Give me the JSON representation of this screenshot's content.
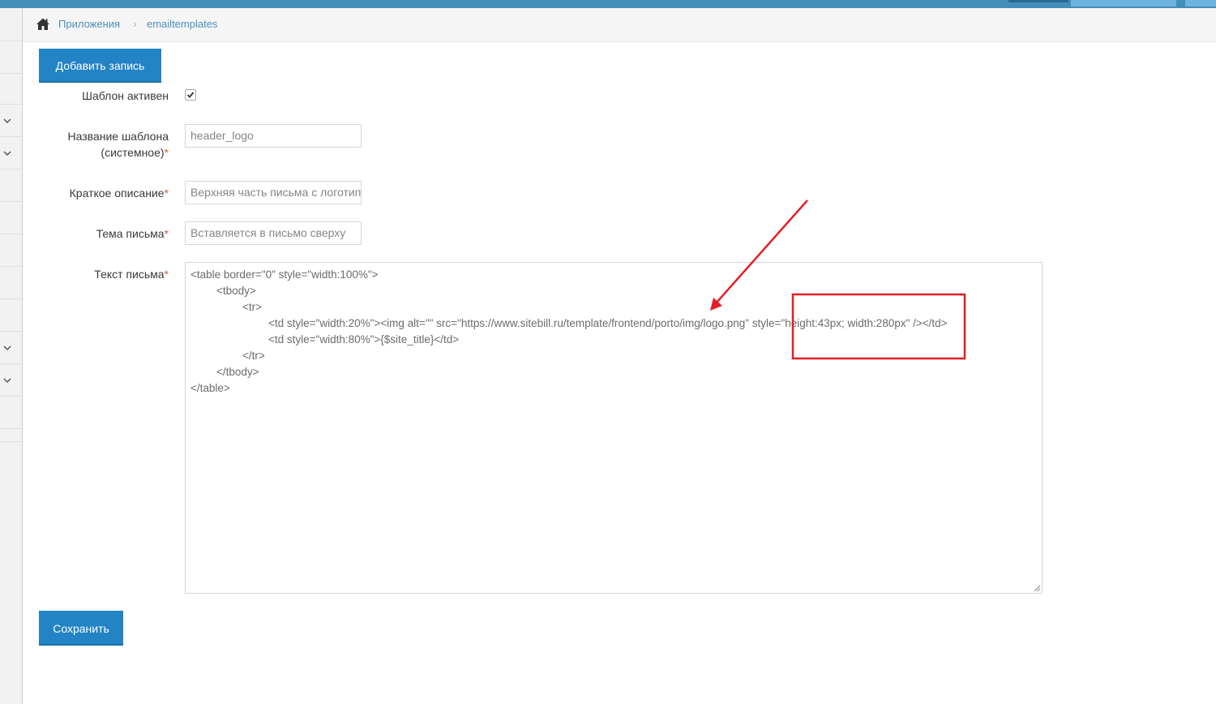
{
  "breadcrumbs": {
    "home_icon": "home-icon",
    "items": [
      "Приложения",
      "emailtemplates"
    ],
    "separator": "›"
  },
  "toolbar": {
    "add_label": "Добавить запись"
  },
  "form": {
    "active": {
      "label": "Шаблон активен",
      "checked": true
    },
    "name": {
      "label_line1": "Название шаблона",
      "label_line2": "(системное)",
      "required": "*",
      "value": "header_logo"
    },
    "description": {
      "label": "Краткое описание",
      "required": "*",
      "value": "Верхняя часть письма с логотипом"
    },
    "subject": {
      "label": "Тема письма",
      "required": "*",
      "value": "Вставляется в письмо сверху"
    },
    "body": {
      "label": "Текст письма",
      "required": "*",
      "lines": [
        "<table border=\"0\" style=\"width:100%\">",
        "<tbody>",
        "<tr>",
        "<td style=\"width:20%\"><img alt=\"\" src=\"https://www.sitebill.ru/template/frontend/porto/img/logo.png\" style=\"height:43px; width:280px\" /></td>",
        "<td style=\"width:80%\">{$site_title}</td>",
        "</tr>",
        "</tbody>",
        "</table>"
      ]
    }
  },
  "save_label": "Сохранить",
  "colors": {
    "accent": "#2283c5",
    "topbar": "#438eb9",
    "annotation": "#e31e24",
    "required": "#d15b47"
  }
}
